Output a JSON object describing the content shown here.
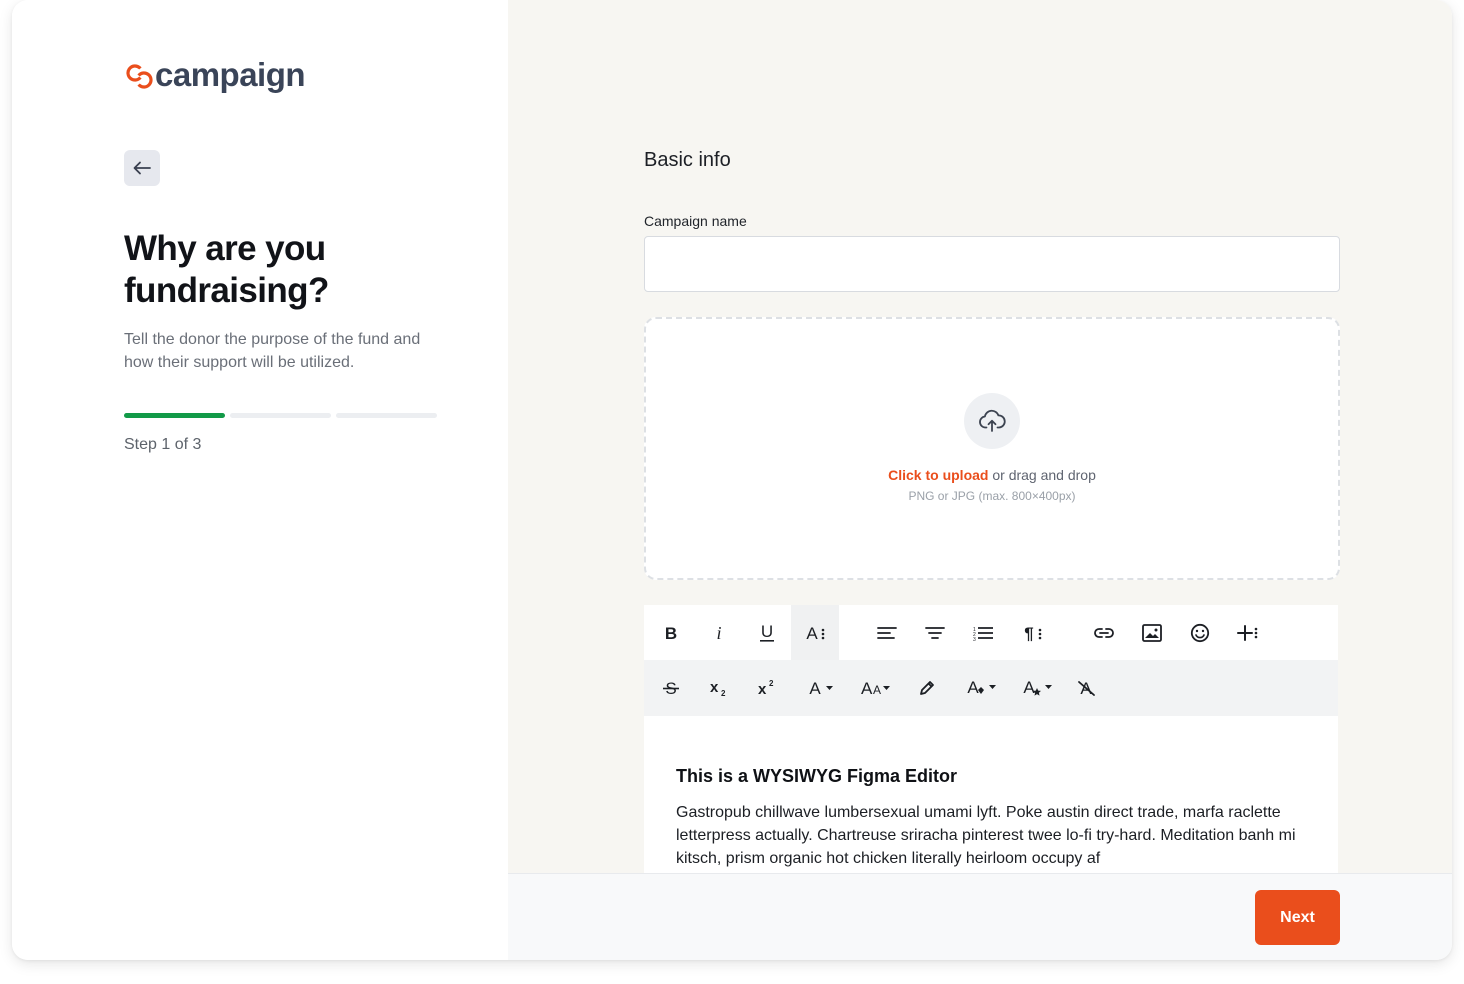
{
  "brand": {
    "name": "campaign",
    "accent": "#ea4e1c",
    "text_color": "#3a4458"
  },
  "left_panel": {
    "back_icon": "arrow-left-icon",
    "headline": "Why are you fundraising?",
    "subtext": "Tell the donor the purpose of the fund and how their support will be utilized.",
    "progress": {
      "current_step": 1,
      "total_steps": 3,
      "active_color": "#129a48"
    },
    "step_label": "Step 1 of 3"
  },
  "form": {
    "section_title": "Basic info",
    "campaign_name": {
      "label": "Campaign name",
      "value": "",
      "placeholder": ""
    },
    "upload": {
      "icon": "cloud-upload-icon",
      "link_text": "Click to upload",
      "rest_text": " or drag and drop",
      "hint": "PNG or JPG (max. 800×400px)"
    }
  },
  "editor": {
    "toolbar_row1": [
      "bold-icon",
      "italic-icon",
      "underline-icon",
      "font-style-icon",
      "align-left-icon",
      "align-center-icon",
      "ordered-list-icon",
      "paragraph-icon",
      "link-icon",
      "image-icon",
      "emoji-icon",
      "insert-more-icon"
    ],
    "toolbar_row2": [
      "strikethrough-icon",
      "subscript-icon",
      "superscript-icon",
      "text-color-icon",
      "font-size-icon",
      "highlight-pen-icon",
      "background-color-icon",
      "text-effect-icon",
      "clear-format-icon"
    ],
    "heading": "This is a WYSIWYG Figma Editor",
    "paragraph": "Gastropub chillwave lumbersexual umami lyft. Poke austin direct trade, marfa raclette letterpress actually. Chartreuse sriracha pinterest twee lo-fi try-hard. Meditation banh mi kitsch, prism organic hot chicken literally heirloom occupy af"
  },
  "footer": {
    "next_label": "Next"
  }
}
